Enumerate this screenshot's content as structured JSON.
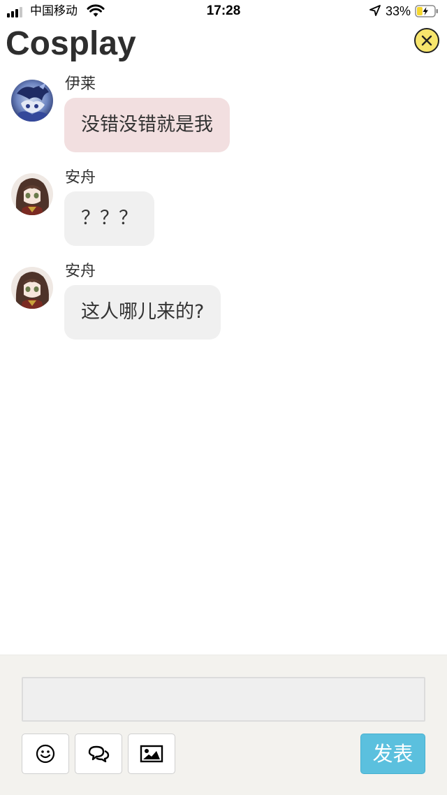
{
  "status_bar": {
    "carrier": "中国移动",
    "time": "17:28",
    "battery_percent": "33%",
    "battery_level": 0.33,
    "icons": [
      "signal-icon",
      "wifi-icon",
      "location-arrow-icon",
      "battery-charging-icon"
    ]
  },
  "header": {
    "title": "Cosplay",
    "close_icon": "close-circle-icon"
  },
  "messages": [
    {
      "sender": "伊莱",
      "text": "没错没错就是我",
      "avatar_icon": "avatar-blue-character",
      "bubble_color": "#f2dfe0"
    },
    {
      "sender": "安舟",
      "text": "？？？",
      "avatar_icon": "avatar-brown-haired-girl",
      "bubble_color": "#f0f0f0"
    },
    {
      "sender": "安舟",
      "text": "这人哪儿来的?",
      "avatar_icon": "avatar-brown-haired-girl",
      "bubble_color": "#f0f0f0"
    }
  ],
  "composer": {
    "input_value": "",
    "input_placeholder": "",
    "tools": [
      "emoji-icon",
      "chat-bubbles-icon",
      "image-icon"
    ],
    "send_label": "发表",
    "send_color": "#5bc0de"
  }
}
